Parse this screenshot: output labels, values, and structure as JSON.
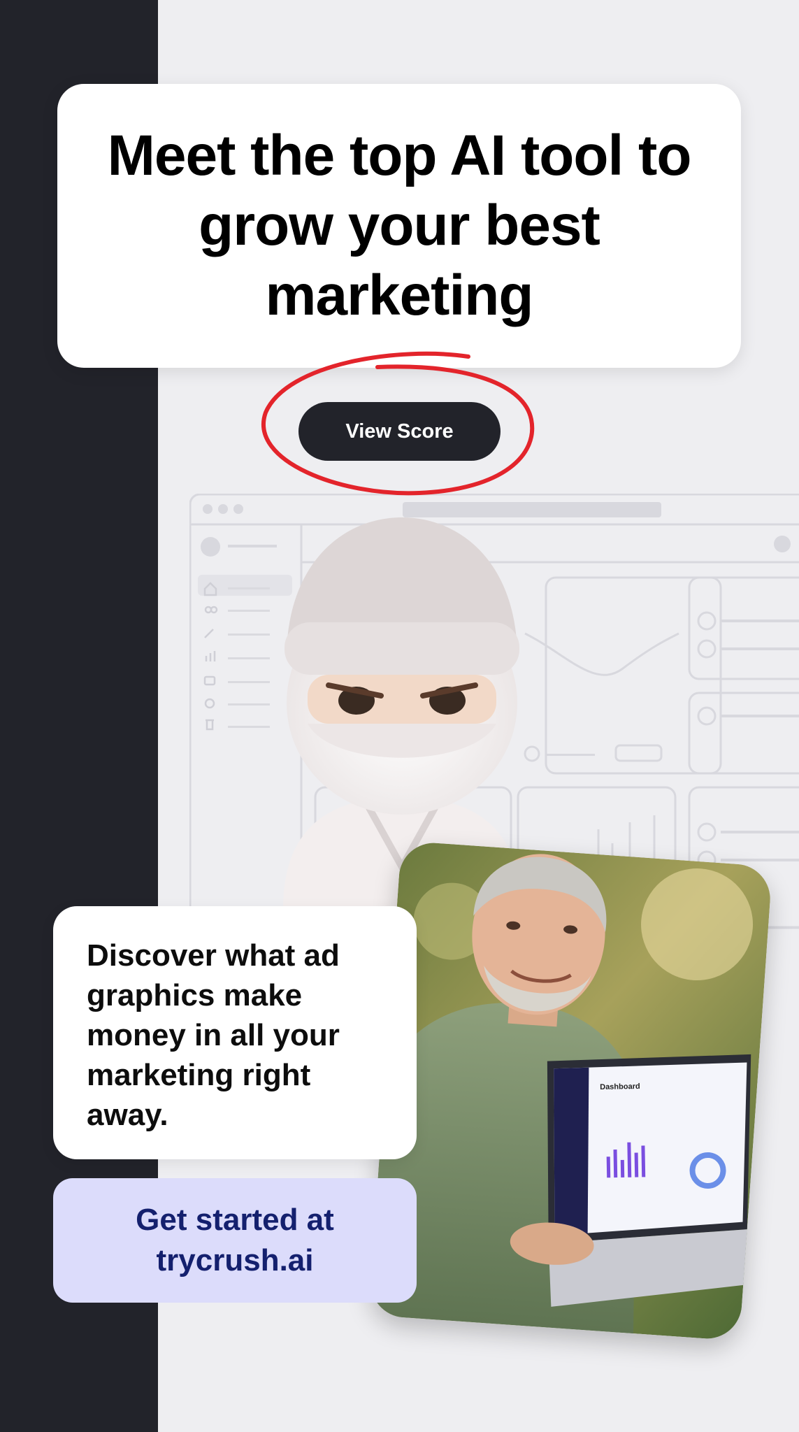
{
  "headline": "Meet the top AI tool to grow your best marketing",
  "cta_button": {
    "label": "View Score"
  },
  "discover_text": "Discover what ad graphics make money in all your marketing right away.",
  "get_started": {
    "line1": "Get started at",
    "line2": "trycrush.ai"
  },
  "laptop_screen": {
    "title": "Dashboard"
  },
  "colors": {
    "dark": "#22232a",
    "background": "#eeeef1",
    "accent_red": "#e3242b",
    "cta_bg": "#dcdcfb",
    "cta_text": "#14206e"
  },
  "icons": [
    "home-icon",
    "users-icon",
    "wrench-icon",
    "bar-chart-icon",
    "folder-icon",
    "settings-icon",
    "trash-icon"
  ]
}
